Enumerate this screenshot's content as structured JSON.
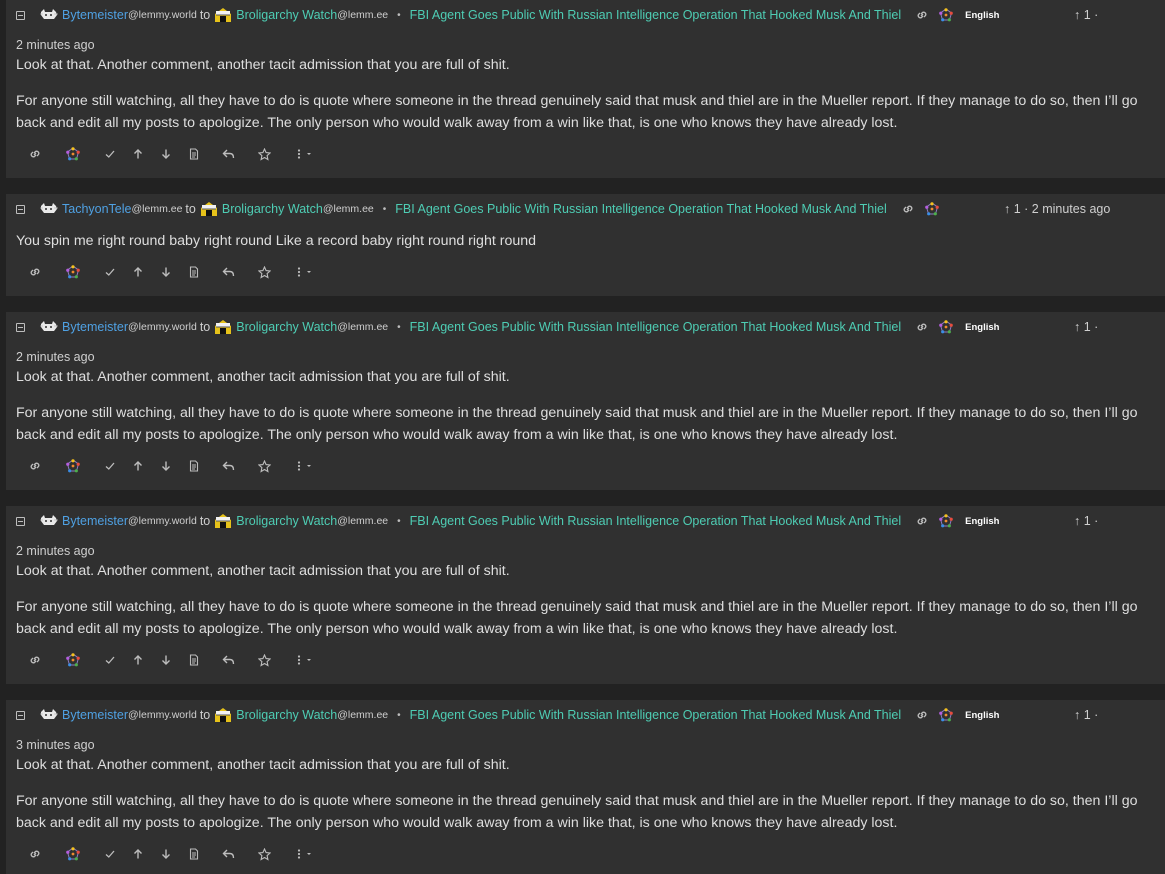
{
  "colors": {
    "background": "#222222",
    "card": "#303030",
    "username": "#4fa1e3",
    "community": "#4ecdb4",
    "text": "#dedede",
    "muted": "#cfcfcf"
  },
  "icons": {
    "collapse": "collapse-toggle-icon",
    "user_avatar": "cat-avatar-icon",
    "community_avatar": "community-avatar-icon",
    "link": "link-icon",
    "federation": "fediverse-icon",
    "actions": [
      "link-icon",
      "fediverse-icon",
      "check-icon",
      "upvote-icon",
      "downvote-icon",
      "view-source-icon",
      "reply-icon",
      "star-icon",
      "more-options-icon"
    ]
  },
  "comments": [
    {
      "user": "Bytemeister",
      "user_instance": "@lemmy.world",
      "to": "to",
      "community": "Broligarchy Watch",
      "community_instance": "@lemm.ee",
      "separator": "•",
      "post_title": "FBI Agent Goes Public With Russian Intelligence Operation That Hooked Musk And Thiel",
      "language": "English",
      "score": "↑ 1 ·",
      "time": "2 minutes ago",
      "paragraphs": [
        "Look at that. Another comment, another tacit admission that you are full of shit.",
        "For anyone still watching, all they have to do is quote where someone in the thread genuinely said that musk and thiel are in the Mueller report. If they manage to do so, then I’ll go back and edit all my posts to apologize. The only person who would walk away from a win like that, is one who knows they have already lost."
      ]
    },
    {
      "user": "TachyonTele",
      "user_instance": "@lemm.ee",
      "to": "to",
      "community": "Broligarchy Watch",
      "community_instance": "@lemm.ee",
      "separator": "•",
      "post_title": "FBI Agent Goes Public With Russian Intelligence Operation That Hooked Musk And Thiel",
      "score": "↑ 1 · 2 minutes ago",
      "paragraphs": [
        "You spin me right round baby right round Like a record baby right round right round"
      ]
    },
    {
      "user": "Bytemeister",
      "user_instance": "@lemmy.world",
      "to": "to",
      "community": "Broligarchy Watch",
      "community_instance": "@lemm.ee",
      "separator": "•",
      "post_title": "FBI Agent Goes Public With Russian Intelligence Operation That Hooked Musk And Thiel",
      "language": "English",
      "score": "↑ 1 ·",
      "time": "2 minutes ago",
      "paragraphs": [
        "Look at that. Another comment, another tacit admission that you are full of shit.",
        "For anyone still watching, all they have to do is quote where someone in the thread genuinely said that musk and thiel are in the Mueller report. If they manage to do so, then I’ll go back and edit all my posts to apologize. The only person who would walk away from a win like that, is one who knows they have already lost."
      ]
    },
    {
      "user": "Bytemeister",
      "user_instance": "@lemmy.world",
      "to": "to",
      "community": "Broligarchy Watch",
      "community_instance": "@lemm.ee",
      "separator": "•",
      "post_title": "FBI Agent Goes Public With Russian Intelligence Operation That Hooked Musk And Thiel",
      "language": "English",
      "score": "↑ 1 ·",
      "time": "2 minutes ago",
      "paragraphs": [
        "Look at that. Another comment, another tacit admission that you are full of shit.",
        "For anyone still watching, all they have to do is quote where someone in the thread genuinely said that musk and thiel are in the Mueller report. If they manage to do so, then I’ll go back and edit all my posts to apologize. The only person who would walk away from a win like that, is one who knows they have already lost."
      ]
    },
    {
      "user": "Bytemeister",
      "user_instance": "@lemmy.world",
      "to": "to",
      "community": "Broligarchy Watch",
      "community_instance": "@lemm.ee",
      "separator": "•",
      "post_title": "FBI Agent Goes Public With Russian Intelligence Operation That Hooked Musk And Thiel",
      "language": "English",
      "score": "↑ 1 ·",
      "time": "3 minutes ago",
      "paragraphs": [
        "Look at that. Another comment, another tacit admission that you are full of shit.",
        "For anyone still watching, all they have to do is quote where someone in the thread genuinely said that musk and thiel are in the Mueller report. If they manage to do so, then I’ll go back and edit all my posts to apologize. The only person who would walk away from a win like that, is one who knows they have already lost."
      ]
    }
  ]
}
